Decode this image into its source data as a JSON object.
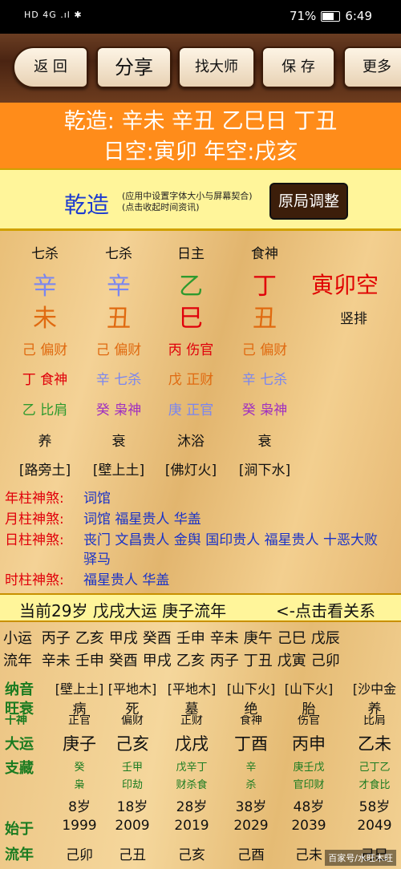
{
  "status": {
    "left": "HD 4G .ıl ✱",
    "battery": "71%",
    "time": "6:49"
  },
  "toolbar": {
    "back": "返 回",
    "share": "分享",
    "master": "找大师",
    "save": "保 存",
    "more": "更多"
  },
  "header": {
    "line1": "乾造: 辛未 辛丑 乙巳日 丁丑",
    "line2": "日空:寅卯 年空:戌亥"
  },
  "banner": {
    "title": "乾造",
    "note1": "(应用中设置字体大小与屏幕契合)",
    "note2": "(点击收起时间资讯)",
    "adjust": "原局调整"
  },
  "pillars": {
    "heads": [
      "七杀",
      "七杀",
      "日主",
      "食神"
    ],
    "stems": [
      "辛",
      "辛",
      "乙",
      "丁"
    ],
    "stem_colors": [
      "#7a86f0",
      "#7a86f0",
      "#2e9a2e",
      "#e0000a"
    ],
    "branches": [
      "未",
      "丑",
      "巳",
      "丑"
    ],
    "branch_colors": [
      "#e06a10",
      "#e06a10",
      "#e0000a",
      "#e06a10"
    ],
    "hidden1": [
      "己 偏财",
      "己 偏财",
      "丙 伤官",
      "己 偏财"
    ],
    "hidden1_colors": [
      "#e06a10",
      "#e06a10",
      "#e0000a",
      "#e06a10"
    ],
    "hidden2": [
      "丁 食神",
      "辛 七杀",
      "戊 正财",
      "辛 七杀"
    ],
    "hidden2_colors": [
      "#e0000a",
      "#7a86f0",
      "#e06a10",
      "#7a86f0"
    ],
    "hidden3": [
      "乙 比肩",
      "癸 枭神",
      "庚 正官",
      "癸 枭神"
    ],
    "hidden3_colors": [
      "#2e9a2e",
      "#a030c0",
      "#7a86f0",
      "#a030c0"
    ],
    "stages": [
      "养",
      "衰",
      "沐浴",
      "衰"
    ],
    "nayin": [
      "[路旁土]",
      "[壁上土]",
      "[佛灯火]",
      "[涧下水]"
    ],
    "empty": "寅卯空",
    "vertical": "竖排"
  },
  "shensha": [
    {
      "k": "年柱神煞:",
      "v": "词馆"
    },
    {
      "k": "月柱神煞:",
      "v": "词馆 福星贵人 华盖"
    },
    {
      "k": "日柱神煞:",
      "v": "丧门 文昌贵人 金舆 国印贵人 福星贵人 十恶大败 驿马"
    },
    {
      "k": "时柱神煞:",
      "v": "福星贵人 华盖"
    }
  ],
  "dayun_bar": {
    "left": "当前29岁 戊戌大运 庚子流年",
    "right": "<-点击看关系"
  },
  "xiaoyun": {
    "label": "小运",
    "items": [
      "丙子",
      "乙亥",
      "甲戌",
      "癸酉",
      "壬申",
      "辛未",
      "庚午",
      "己巳",
      "戊辰"
    ]
  },
  "liunian_row": {
    "label": "流年",
    "items": [
      "辛未",
      "壬申",
      "癸酉",
      "甲戌",
      "乙亥",
      "丙子",
      "丁丑",
      "戊寅",
      "己卯"
    ]
  },
  "table": {
    "labels": {
      "nayin": "纳音",
      "wangshuai": "旺衰",
      "shishen": "十神",
      "dayun": "大运",
      "zhicang": "支藏",
      "shiyu": "始于",
      "liunian": "流年"
    },
    "nayin": [
      "[壁上土]",
      "[平地木]",
      "[平地木]",
      "[山下火]",
      "[山下火]",
      "[沙中金"
    ],
    "wangshuai": [
      "病",
      "死",
      "墓",
      "绝",
      "胎",
      "养"
    ],
    "shishen": [
      "正官",
      "偏财",
      "正财",
      "食神",
      "伤官",
      "比肩"
    ],
    "dayun": [
      "庚子",
      "己亥",
      "戊戌",
      "丁酉",
      "丙申",
      "乙未"
    ],
    "zhicang1": [
      "癸",
      "壬甲",
      "戊辛丁",
      "辛",
      "庚壬戊",
      "己丁乙"
    ],
    "zhicang2": [
      "枭",
      "印劫",
      "财杀食",
      "杀",
      "官印财",
      "才食比"
    ],
    "ages": [
      "8岁",
      "18岁",
      "28岁",
      "38岁",
      "48岁",
      "58岁"
    ],
    "years": [
      "1999",
      "2009",
      "2019",
      "2029",
      "2039",
      "2049"
    ],
    "liunian": [
      "己卯",
      "己丑",
      "己亥",
      "己酉",
      "己未",
      "己巳"
    ]
  },
  "watermark": "百家号/水旺木旺"
}
